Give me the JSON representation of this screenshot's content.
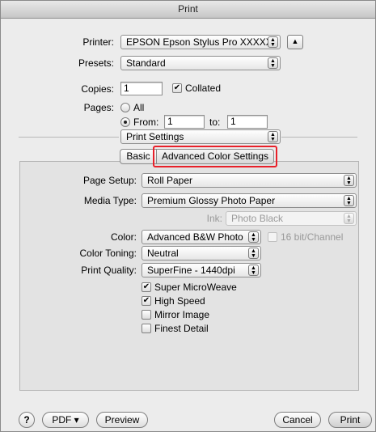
{
  "window": {
    "title": "Print"
  },
  "printer": {
    "label": "Printer:",
    "value": "EPSON Epson Stylus Pro XXXXX"
  },
  "presets": {
    "label": "Presets:",
    "value": "Standard"
  },
  "copies": {
    "label": "Copies:",
    "value": "1",
    "collated_label": "Collated",
    "collated_checked": true
  },
  "pages": {
    "label": "Pages:",
    "all_label": "All",
    "from_label": "From:",
    "from_value": "1",
    "to_label": "to:",
    "to_value": "1",
    "selected": "from"
  },
  "section_popup": {
    "value": "Print Settings"
  },
  "tabs": [
    {
      "label": "Basic",
      "selected": false
    },
    {
      "label": "Advanced Color Settings",
      "selected": true
    }
  ],
  "settings": {
    "page_setup": {
      "label": "Page Setup:",
      "value": "Roll Paper"
    },
    "media_type": {
      "label": "Media Type:",
      "value": "Premium Glossy Photo Paper"
    },
    "ink": {
      "label": "Ink:",
      "value": "Photo Black"
    },
    "color": {
      "label": "Color:",
      "value": "Advanced B&W Photo",
      "bit_label": "16 bit/Channel"
    },
    "color_toning": {
      "label": "Color Toning:",
      "value": "Neutral"
    },
    "print_quality": {
      "label": "Print Quality:",
      "value": "SuperFine - 1440dpi"
    },
    "options": [
      {
        "label": "Super MicroWeave",
        "checked": true
      },
      {
        "label": "High Speed",
        "checked": true
      },
      {
        "label": "Mirror Image",
        "checked": false
      },
      {
        "label": "Finest Detail",
        "checked": false
      }
    ]
  },
  "footer": {
    "help_label": "?",
    "pdf_label": "PDF ▾",
    "preview_label": "Preview",
    "cancel_label": "Cancel",
    "print_label": "Print"
  },
  "colors": {
    "highlight": "#e8202a",
    "window_bg": "#ececec",
    "panel_bg": "#e3e3e3"
  }
}
